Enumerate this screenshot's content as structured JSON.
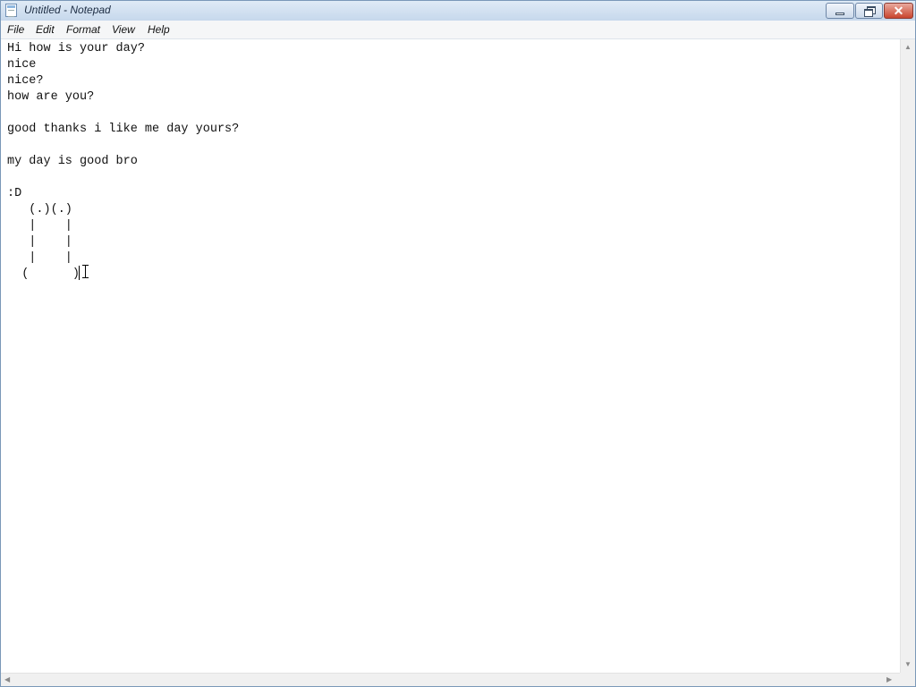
{
  "window": {
    "title": "Untitled - Notepad",
    "close_label": "✕"
  },
  "menu": {
    "file": "File",
    "edit": "Edit",
    "format": "Format",
    "view": "View",
    "help": "Help"
  },
  "editor": {
    "text": "Hi how is your day?\nnice\nnice?\nhow are you?\n\ngood thanks i like me day yours?\n\nmy day is good bro\n\n:D\n   (.)(.)\n   |    |\n   |    |\n   |    |\n  (      )"
  },
  "scrollbars": {
    "up_arrow": "▲",
    "down_arrow": "▼",
    "left_arrow": "◀",
    "right_arrow": "▶"
  },
  "icons": {
    "app": "notepad-icon",
    "minimize": "minimize-icon",
    "maximize": "restore-icon",
    "close": "close-icon",
    "cursor": "text-cursor-icon"
  },
  "colors": {
    "titlebar": "#c6d8ec",
    "close_button": "#c9452f",
    "menubar": "#f5f6f7",
    "editor_bg": "#ffffff",
    "text": "#111111"
  }
}
